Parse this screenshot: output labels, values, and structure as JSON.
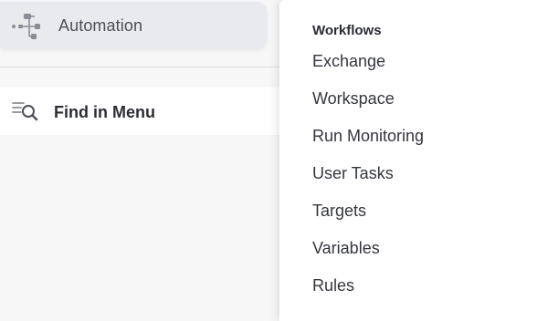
{
  "sidebar": {
    "automation": {
      "label": "Automation",
      "icon": "workflow-icon"
    },
    "find_menu": {
      "label": "Find in Menu",
      "icon": "search-list-icon"
    }
  },
  "flyout": {
    "heading": "Workflows",
    "items": [
      {
        "label": "Exchange"
      },
      {
        "label": "Workspace"
      },
      {
        "label": "Run Monitoring"
      },
      {
        "label": "User Tasks"
      },
      {
        "label": "Targets"
      },
      {
        "label": "Variables"
      },
      {
        "label": "Rules"
      }
    ]
  },
  "colors": {
    "sidebar_bg": "#f7f7f8",
    "active_item_bg": "#e9eaee",
    "flyout_bg": "#ffffff",
    "text": "#34363d"
  }
}
